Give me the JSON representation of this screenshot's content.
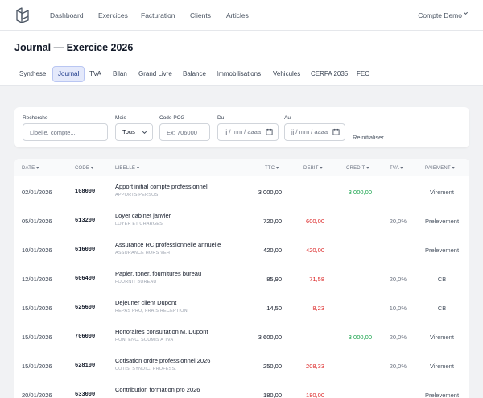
{
  "nav": {
    "items": [
      "Dashboard",
      "Exercices",
      "Facturation",
      "Clients",
      "Articles"
    ],
    "account": "Compte Demo"
  },
  "header": {
    "title": "Journal — Exercice 2026",
    "tabs": [
      "Synthese",
      "Journal",
      "TVA",
      "Bilan",
      "Grand Livre",
      "Balance",
      "Immobilisations",
      "Vehicules",
      "CERFA 2035",
      "FEC"
    ],
    "active_tab": "Journal"
  },
  "filters": {
    "search_label": "Recherche",
    "search_placeholder": "Libelle, compte...",
    "month_label": "Mois",
    "month_value": "Tous",
    "pcg_label": "Code PCG",
    "pcg_placeholder": "Ex: 706000",
    "from_label": "Du",
    "from_placeholder": "jj / mm / aaaa",
    "to_label": "Au",
    "to_placeholder": "jj / mm / aaaa",
    "reset_label": "Reinitialiser"
  },
  "table": {
    "columns": {
      "date": "DATE",
      "code": "CODE",
      "libelle": "LIBELLE",
      "ttc": "TTC",
      "debit": "DEBIT",
      "credit": "CREDIT",
      "tva": "TVA",
      "paiement": "PAIEMENT"
    },
    "sort_arrow": "▾",
    "rows": [
      {
        "date": "02/01/2026",
        "code": "108000",
        "libelle": "Apport initial compte professionnel",
        "sub": "APPORTS PERSOS",
        "ttc": "3 000,00",
        "debit": "",
        "credit": "3 000,00",
        "tva": "—",
        "paiement": "Virement"
      },
      {
        "date": "05/01/2026",
        "code": "613200",
        "libelle": "Loyer cabinet janvier",
        "sub": "LOYER ET CHARGES",
        "ttc": "720,00",
        "debit": "600,00",
        "credit": "",
        "tva": "20,0%",
        "paiement": "Prelevement"
      },
      {
        "date": "10/01/2026",
        "code": "616000",
        "libelle": "Assurance RC professionnelle annuelle",
        "sub": "ASSURANCE HORS VEH",
        "ttc": "420,00",
        "debit": "420,00",
        "credit": "",
        "tva": "—",
        "paiement": "Prelevement"
      },
      {
        "date": "12/01/2026",
        "code": "606400",
        "libelle": "Papier, toner, fournitures bureau",
        "sub": "FOURNIT BUREAU",
        "ttc": "85,90",
        "debit": "71,58",
        "credit": "",
        "tva": "20,0%",
        "paiement": "CB"
      },
      {
        "date": "15/01/2026",
        "code": "625600",
        "libelle": "Dejeuner client Dupont",
        "sub": "REPAS PRO, FRAIS RECEPTION",
        "ttc": "14,50",
        "debit": "8,23",
        "credit": "",
        "tva": "10,0%",
        "paiement": "CB"
      },
      {
        "date": "15/01/2026",
        "code": "706000",
        "libelle": "Honoraires consultation M. Dupont",
        "sub": "HON. ENC. SOUMIS A TVA",
        "ttc": "3 600,00",
        "debit": "",
        "credit": "3 000,00",
        "tva": "20,0%",
        "paiement": "Virement"
      },
      {
        "date": "15/01/2026",
        "code": "628100",
        "libelle": "Cotisation ordre professionnel 2026",
        "sub": "COTIS. SYNDIC. PROFESS.",
        "ttc": "250,00",
        "debit": "208,33",
        "credit": "",
        "tva": "20,0%",
        "paiement": "Virement"
      },
      {
        "date": "20/01/2026",
        "code": "633000",
        "libelle": "Contribution formation pro 2026",
        "sub": "",
        "ttc": "180,00",
        "debit": "180,00",
        "credit": "",
        "tva": "—",
        "paiement": "Prelevement"
      }
    ]
  },
  "colors": {
    "debit": "#dc2626",
    "credit": "#16a34a",
    "active_tab_bg": "#e4e9fb"
  }
}
